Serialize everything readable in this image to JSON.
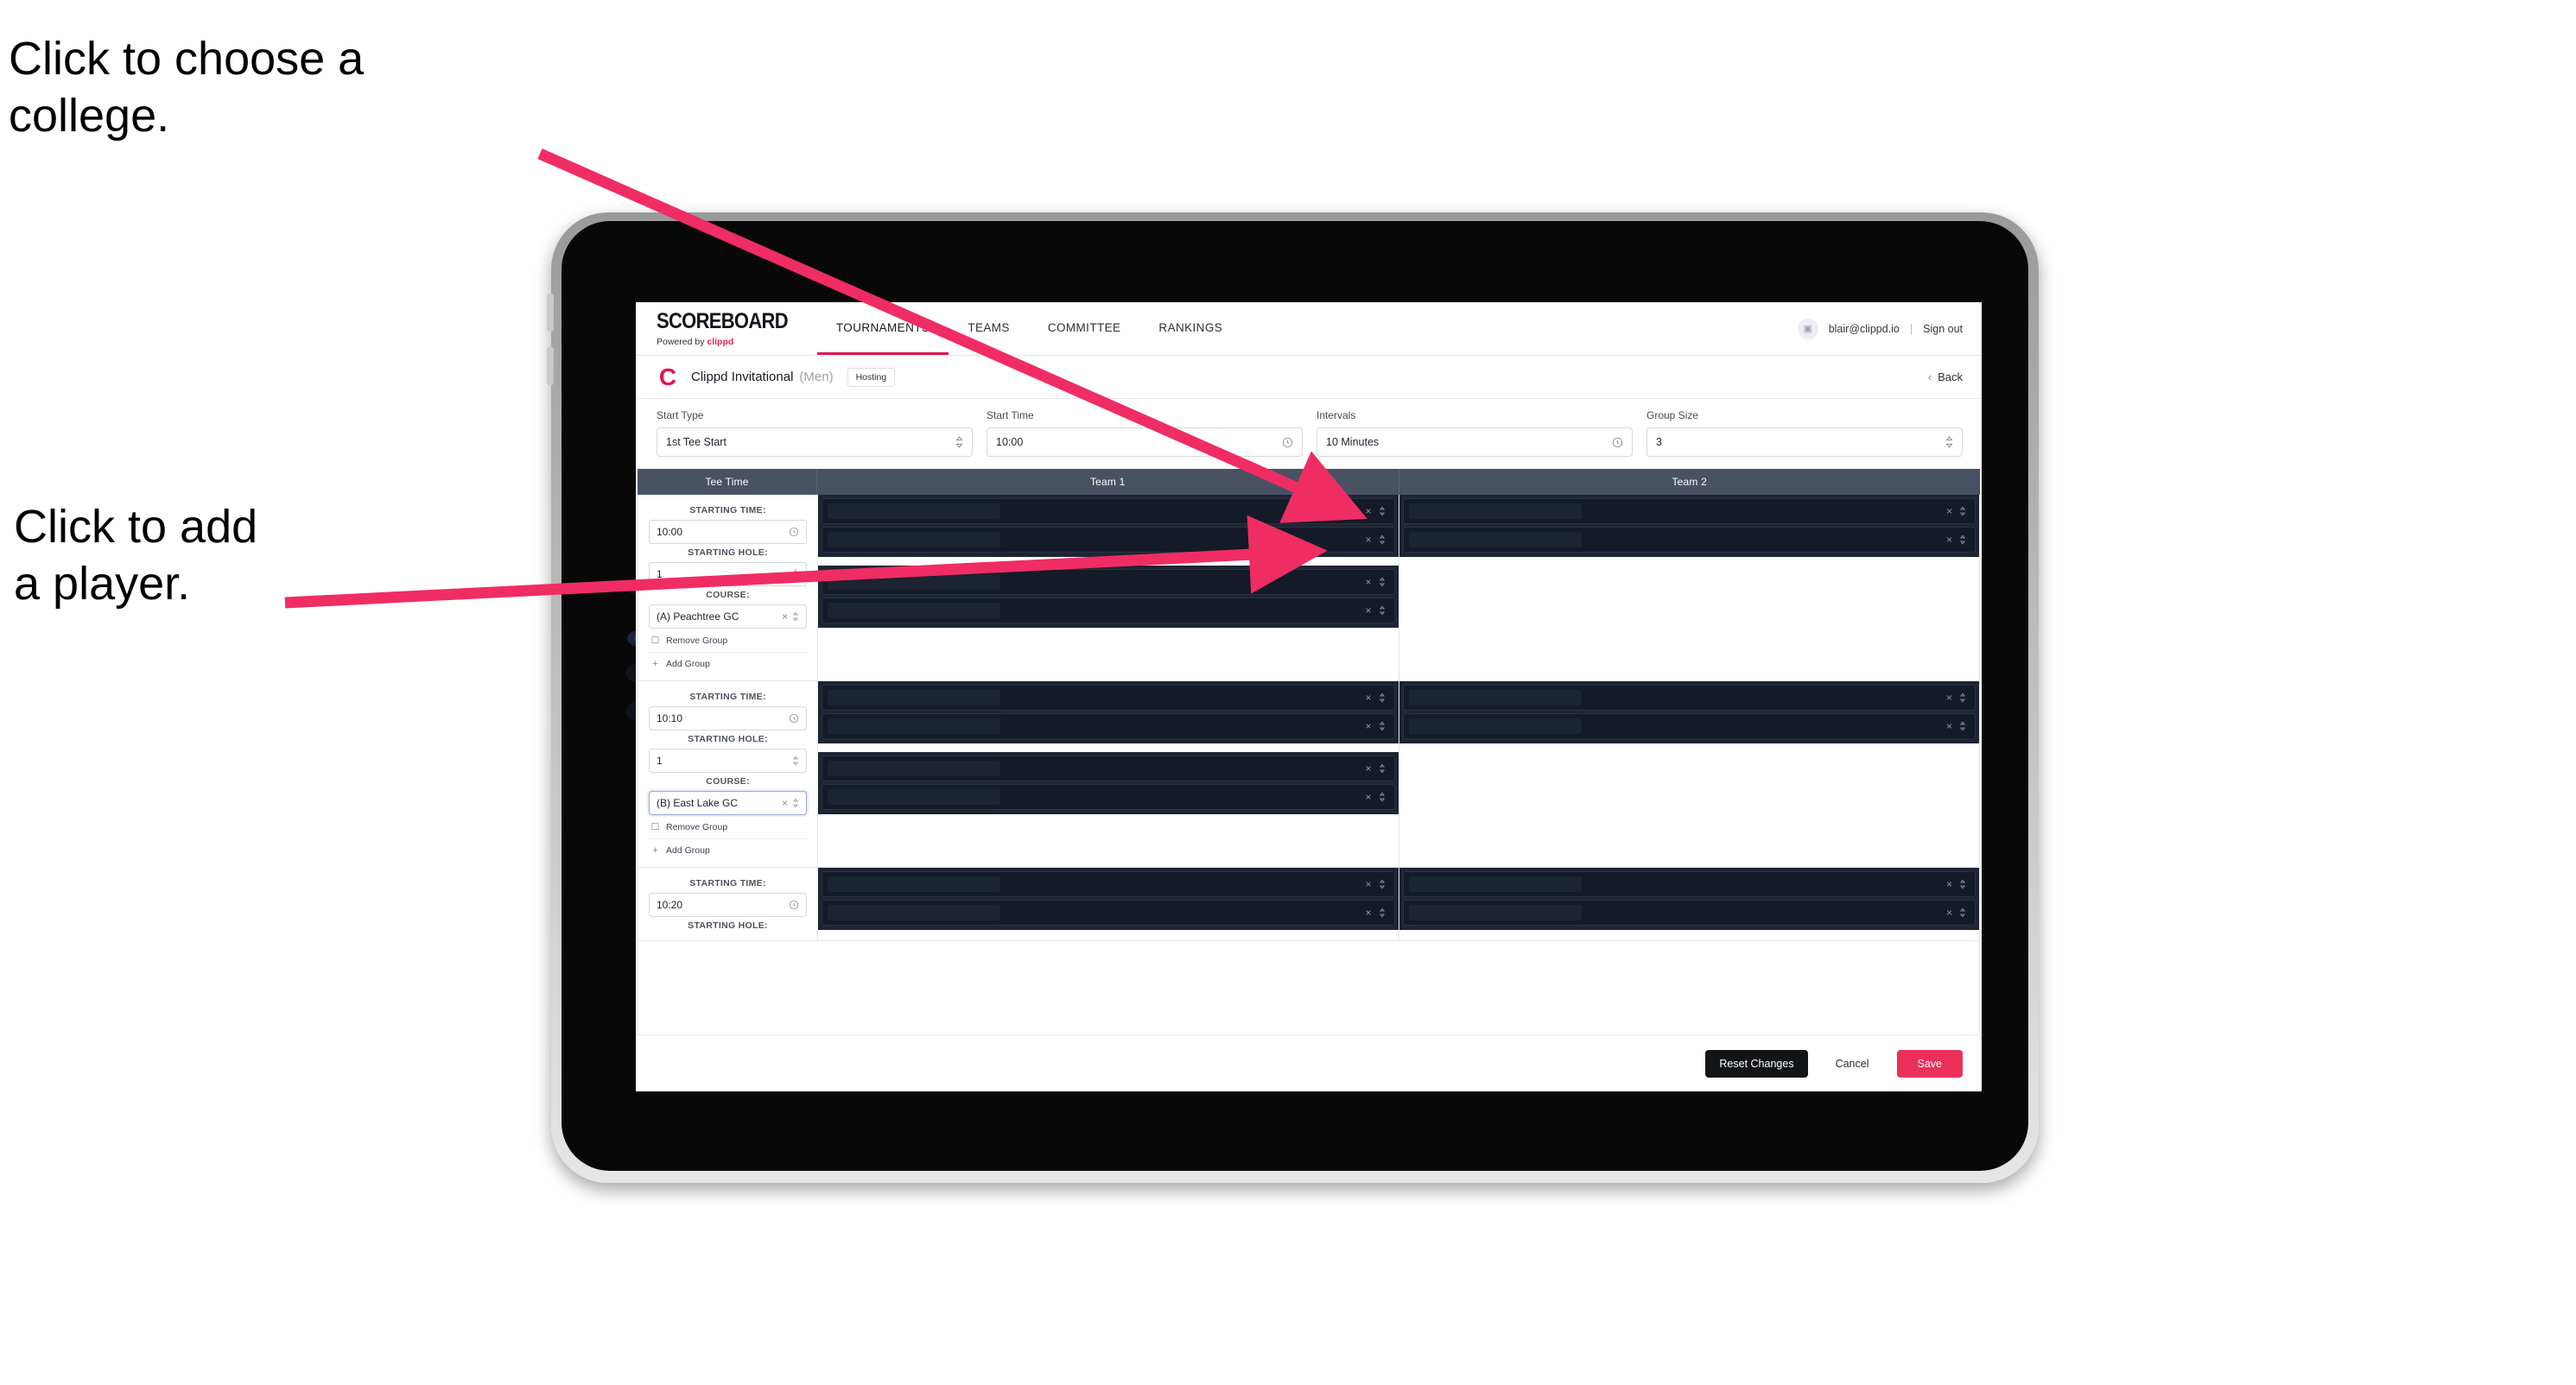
{
  "annotations": [
    {
      "id": "choose-college",
      "text": "Click to choose a\ncollege."
    },
    {
      "id": "add-player",
      "text": "Click to add\na player."
    }
  ],
  "accent": {
    "brand_pink": "#ea1f55",
    "save_pink": "#ea2f5b",
    "arrow_pink": "#ef2d63",
    "table_header": "#4a5163",
    "player_row_dark": "#141a27"
  },
  "nav": {
    "brand_title": "SCOREBOARD",
    "brand_sub_prefix": "Powered by ",
    "brand_sub_name": "clippd",
    "tabs": [
      {
        "label": "TOURNAMENTS",
        "active": true
      },
      {
        "label": "TEAMS",
        "active": false
      },
      {
        "label": "COMMITTEE",
        "active": false
      },
      {
        "label": "RANKINGS",
        "active": false
      }
    ],
    "avatar_glyph": "▣",
    "user_email": "blair@clippd.io",
    "separator": "|",
    "sign_out": "Sign out"
  },
  "tournament_bar": {
    "logo_letter": "C",
    "name": "Clippd Invitational",
    "gender": "(Men)",
    "hosting_badge": "Hosting",
    "back_chevron": "‹",
    "back_label": "Back"
  },
  "settings": [
    {
      "label": "Start Type",
      "value": "1st Tee Start",
      "icon": "stepper-icon"
    },
    {
      "label": "Start Time",
      "value": "10:00",
      "icon": "clock-icon"
    },
    {
      "label": "Intervals",
      "value": "10 Minutes",
      "icon": "clock-icon"
    },
    {
      "label": "Group Size",
      "value": "3",
      "icon": "stepper-icon"
    }
  ],
  "table": {
    "columns": [
      {
        "key": "tee",
        "header": "Tee Time"
      },
      {
        "key": "team1",
        "header": "Team 1"
      },
      {
        "key": "team2",
        "header": "Team 2"
      }
    ],
    "labels": {
      "starting_time": "STARTING TIME:",
      "starting_hole": "STARTING HOLE:",
      "course": "COURSE:",
      "remove_group": "Remove Group",
      "add_group": "Add Group",
      "trash_icon": "☐",
      "plus_icon": "+",
      "clear_icon": "×",
      "stepper_icon": "⇅"
    },
    "rows": [
      {
        "starting_time": "10:00",
        "starting_hole": "1",
        "course": "(A) Peachtree GC",
        "course_focused": false,
        "team1_groups": [
          {
            "players": [
              {
                "redacted_width": 200
              },
              {
                "redacted_width": 200
              }
            ]
          },
          {
            "players": [
              {
                "redacted_width": 200
              },
              {
                "redacted_width": 200
              }
            ]
          }
        ],
        "team2_groups": [
          {
            "players": [
              {
                "redacted_width": 200
              },
              {
                "redacted_width": 200
              }
            ]
          }
        ]
      },
      {
        "starting_time": "10:10",
        "starting_hole": "1",
        "course": "(B) East Lake GC",
        "course_focused": true,
        "team1_groups": [
          {
            "players": [
              {
                "redacted_width": 200
              },
              {
                "redacted_width": 200
              }
            ]
          },
          {
            "players": [
              {
                "redacted_width": 200
              },
              {
                "redacted_width": 200
              }
            ]
          }
        ],
        "team2_groups": [
          {
            "players": [
              {
                "redacted_width": 200
              },
              {
                "redacted_width": 200
              }
            ]
          }
        ]
      },
      {
        "starting_time": "10:20",
        "starting_hole": "",
        "course": "",
        "course_focused": false,
        "team1_groups": [
          {
            "players": [
              {
                "redacted_width": 200
              },
              {
                "redacted_width": 200
              }
            ]
          }
        ],
        "team2_groups": [
          {
            "players": [
              {
                "redacted_width": 200
              },
              {
                "redacted_width": 200
              }
            ]
          }
        ]
      }
    ]
  },
  "footer": {
    "reset_label": "Reset Changes",
    "cancel_label": "Cancel",
    "save_label": "Save"
  }
}
